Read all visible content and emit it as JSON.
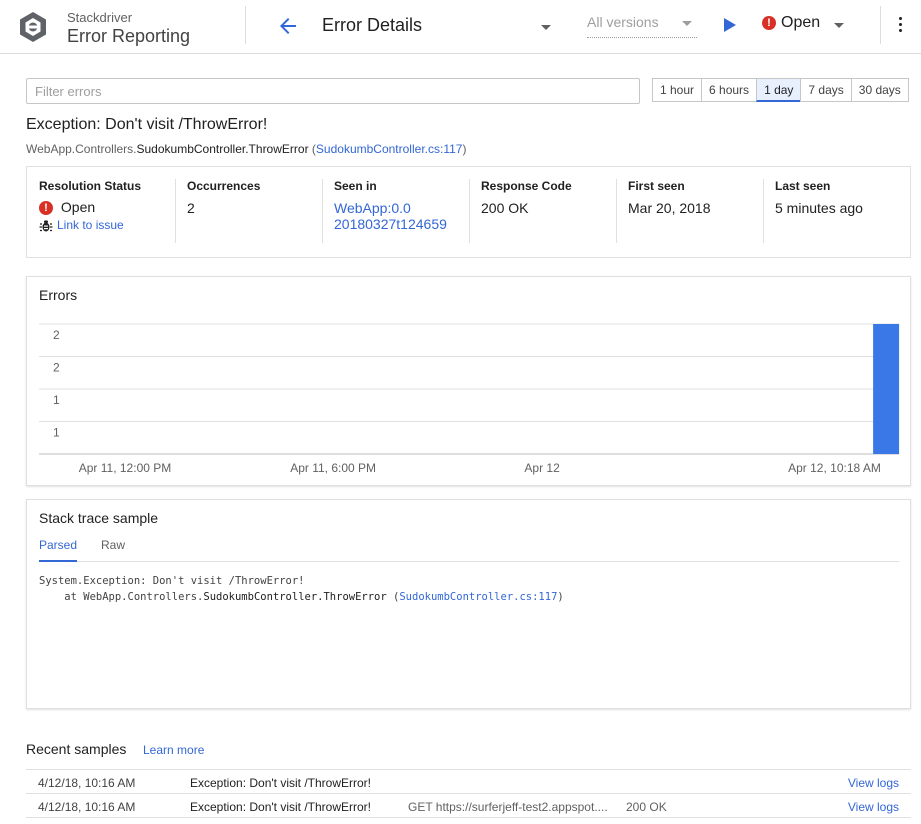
{
  "header": {
    "brand_top": "Stackdriver",
    "brand_main": "Error Reporting",
    "page_title": "Error Details",
    "versions_label": "All versions",
    "status_label": "Open"
  },
  "filter": {
    "placeholder": "Filter errors"
  },
  "time_ranges": [
    "1 hour",
    "6 hours",
    "1 day",
    "7 days",
    "30 days"
  ],
  "time_range_selected": "1 day",
  "exception": {
    "title": "Exception: Don't visit /ThrowError!",
    "method_prefix": "WebApp.Controllers.",
    "method_bold": "SudokumbController.ThrowError",
    "source_open": " (",
    "source_link": "SudokumbController.cs:117",
    "source_close": ")"
  },
  "info": {
    "resolution_label": "Resolution Status",
    "resolution_value": "Open",
    "link_to_issue": "Link to issue",
    "occurrences_label": "Occurrences",
    "occurrences_value": "2",
    "seen_in_label": "Seen in",
    "seen_in_line1": "WebApp:0.0",
    "seen_in_line2": "20180327t124659",
    "response_label": "Response Code",
    "response_value": "200 OK",
    "first_seen_label": "First seen",
    "first_seen_value": "Mar 20, 2018",
    "last_seen_label": "Last seen",
    "last_seen_value": "5 minutes ago"
  },
  "chart_data": {
    "type": "bar",
    "title": "Errors",
    "y_tick_labels": [
      "2",
      "2",
      "1",
      "1"
    ],
    "x_tick_labels": [
      "Apr 11, 12:00 PM",
      "Apr 11, 6:00 PM",
      "Apr 12",
      "Apr 12, 10:18 AM"
    ],
    "ylim": [
      0,
      2
    ],
    "grid": true,
    "bars": [
      {
        "x_fraction_of_range": 0.985,
        "value": 2
      }
    ],
    "bar_color": "#3b78e7"
  },
  "stack_trace": {
    "title": "Stack trace sample",
    "tabs": [
      "Parsed",
      "Raw"
    ],
    "active_tab": "Parsed",
    "line1": "System.Exception: Don't visit /ThrowError!",
    "line2_prefix": "    at WebApp.Controllers.",
    "line2_method": "SudokumbController.ThrowError",
    "line2_open": " (",
    "line2_link": "SudokumbController.cs:117",
    "line2_close": ")"
  },
  "recent": {
    "title": "Recent samples",
    "learn_more": "Learn more",
    "rows": [
      {
        "time": "4/12/18, 10:16 AM",
        "message": "Exception: Don't visit /ThrowError!",
        "request": "",
        "code": "",
        "logs": "View logs"
      },
      {
        "time": "4/12/18, 10:16 AM",
        "message": "Exception: Don't visit /ThrowError!",
        "request": "GET https://surferjeff-test2.appspot....",
        "code": "200 OK",
        "logs": "View logs"
      }
    ]
  },
  "colors": {
    "accent": "#3367d6",
    "error": "#d93025",
    "bar": "#3b78e7"
  }
}
